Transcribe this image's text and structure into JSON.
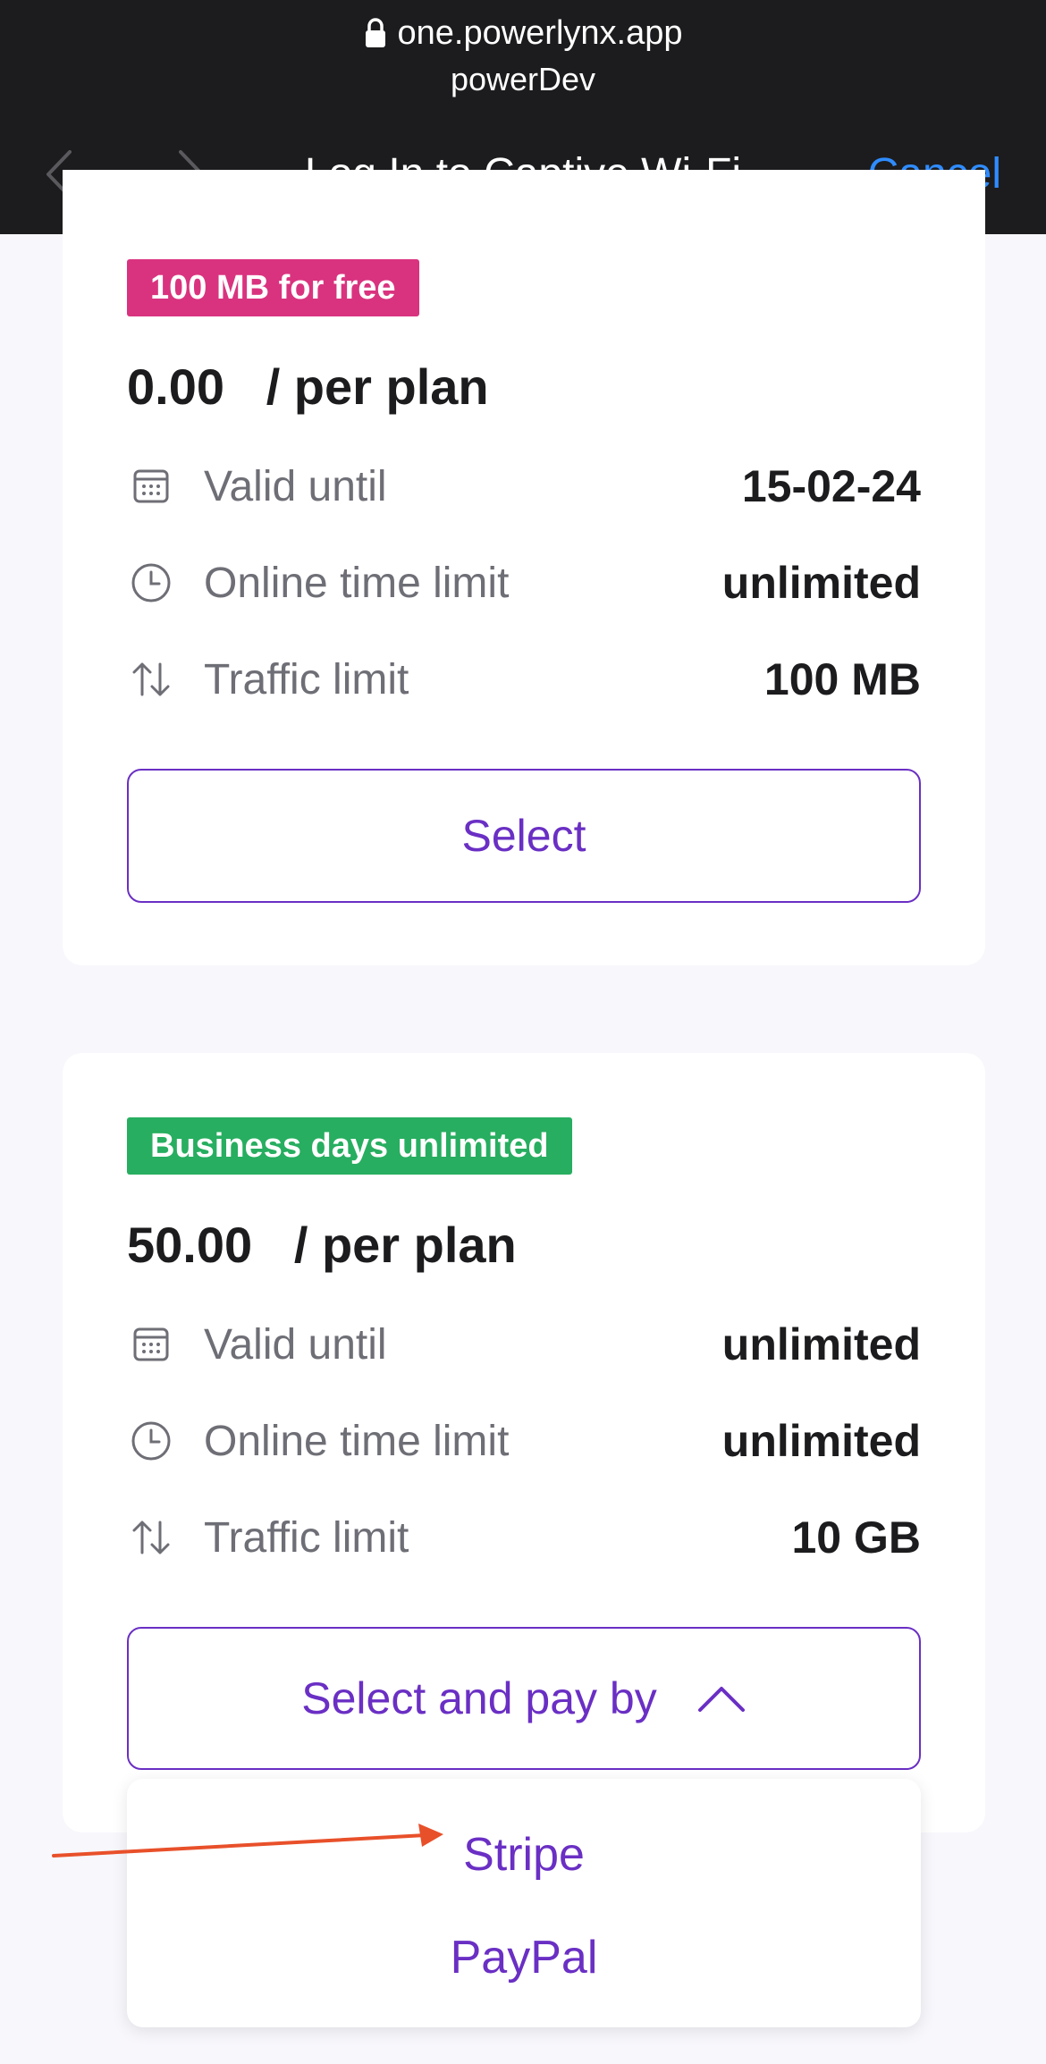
{
  "browser": {
    "url": "one.powerlynx.app",
    "subtitle": "powerDev",
    "title": "Log In to Captive Wi-Fi",
    "cancel_label": "Cancel"
  },
  "plans": [
    {
      "badge": "100 MB for free",
      "badge_color": "#d9337f",
      "price": "0.00",
      "price_suffix": "/ per plan",
      "features": [
        {
          "icon": "calendar-icon",
          "label": "Valid until",
          "value": "15-02-24"
        },
        {
          "icon": "clock-icon",
          "label": "Online time limit",
          "value": "unlimited"
        },
        {
          "icon": "up-down-arrows-icon",
          "label": "Traffic limit",
          "value": "100 MB"
        }
      ],
      "button_label": "Select"
    },
    {
      "badge": "Business days unlimited",
      "badge_color": "#27ae60",
      "price": "50.00",
      "price_suffix": "/ per plan",
      "features": [
        {
          "icon": "calendar-icon",
          "label": "Valid until",
          "value": "unlimited"
        },
        {
          "icon": "clock-icon",
          "label": "Online time limit",
          "value": "unlimited"
        },
        {
          "icon": "up-down-arrows-icon",
          "label": "Traffic limit",
          "value": "10 GB"
        }
      ],
      "button_label": "Select and pay by"
    }
  ],
  "payment_options": [
    "Stripe",
    "PayPal"
  ],
  "colors": {
    "accent": "#6a2fc4",
    "link": "#2f8cff",
    "annotation_arrow": "#e8502a"
  }
}
